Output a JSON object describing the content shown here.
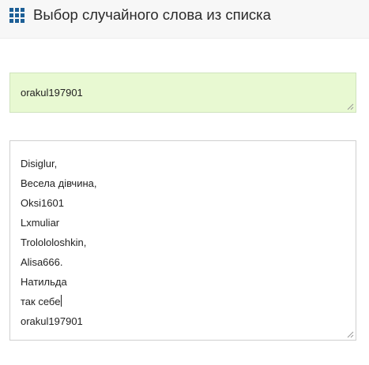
{
  "header": {
    "icon": "grid-menu-icon",
    "title": "Выбор случайного слова из списка"
  },
  "result": {
    "value": "orakul197901",
    "background": "#e8f9d2"
  },
  "word_list": {
    "items": [
      "Disiglur,",
      "Весела дівчина,",
      "Oksi1601",
      "Lxmuliar",
      "Trolololoshkin,",
      "Alisa666.",
      "Натильда",
      "так себе",
      "orakul197901"
    ]
  },
  "colors": {
    "icon": "#1d5f96",
    "header_bg": "#f7f7f7"
  }
}
